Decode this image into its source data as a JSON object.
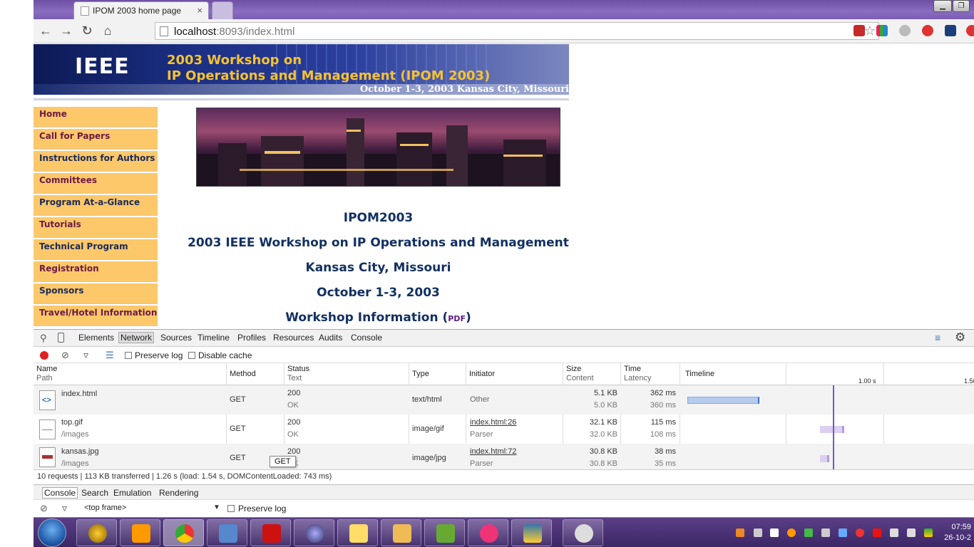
{
  "browser": {
    "tab_title": "IPOM 2003 home page",
    "tab_close": "×",
    "url_host": "localhost",
    "url_rest": ":8093/index.html"
  },
  "banner": {
    "logo": "IEEE",
    "title_line1": "2003 Workshop on",
    "title_line2": "IP Operations and Management (IPOM 2003)",
    "date_line": "October 1-3, 2003 Kansas City, Missouri"
  },
  "sidebar": {
    "items": [
      {
        "label": "Home",
        "color": "maroon"
      },
      {
        "label": "Call for Papers",
        "color": "maroon"
      },
      {
        "label": "Instructions for Authors",
        "color": "navy"
      },
      {
        "label": "Committees",
        "color": "maroon"
      },
      {
        "label": "Program At-a-Glance",
        "color": "navy"
      },
      {
        "label": "Tutorials",
        "color": "maroon"
      },
      {
        "label": "Technical Program",
        "color": "navy"
      },
      {
        "label": "Registration",
        "color": "maroon"
      },
      {
        "label": "Sponsors",
        "color": "navy"
      },
      {
        "label": "Travel/Hotel Information",
        "color": "maroon"
      }
    ]
  },
  "main": {
    "heading1": "IPOM2003",
    "heading2": "2003 IEEE Workshop on IP Operations and Management",
    "heading3": "Kansas City, Missouri",
    "heading4": "October 1-3, 2003",
    "heading5_prefix": "Workshop Information (",
    "heading5_link": "PDF",
    "heading5_suffix": ")"
  },
  "devtools": {
    "tabs": [
      "Elements",
      "Network",
      "Sources",
      "Timeline",
      "Profiles",
      "Resources",
      "Audits",
      "Console"
    ],
    "selected_tab": "Network",
    "preserve_log": "Preserve log",
    "disable_cache": "Disable cache",
    "headers": {
      "name": "Name",
      "path": "Path",
      "method": "Method",
      "status": "Status",
      "text": "Text",
      "type": "Type",
      "initiator": "Initiator",
      "size": "Size",
      "content": "Content",
      "time": "Time",
      "latency": "Latency",
      "timeline": "Timeline",
      "tick1": "1.00 s",
      "tick2": "1.50"
    },
    "rows": [
      {
        "name": "index.html",
        "path": "",
        "method": "GET",
        "status": "200",
        "status_text": "OK",
        "type": "text/html",
        "initiator": "Other",
        "initiator_sub": "",
        "size": "5.1 KB",
        "content": "5.0 KB",
        "time": "362 ms",
        "latency": "360 ms"
      },
      {
        "name": "top.gif",
        "path": "/images",
        "method": "GET",
        "status": "200",
        "status_text": "OK",
        "type": "image/gif",
        "initiator": "index.html:26",
        "initiator_sub": "Parser",
        "size": "32.1 KB",
        "content": "32.0 KB",
        "time": "115 ms",
        "latency": "108 ms"
      },
      {
        "name": "kansas.jpg",
        "path": "/images",
        "method": "GET",
        "status": "200",
        "status_text": "OK",
        "type": "image/jpg",
        "initiator": "index.html:72",
        "initiator_sub": "Parser",
        "size": "30.8 KB",
        "content": "30.8 KB",
        "time": "38 ms",
        "latency": "35 ms"
      }
    ],
    "summary": "10 requests | 113 KB transferred | 1.26 s (load: 1.54 s, DOMContentLoaded: 743 ms)",
    "tooltip": "GET",
    "drawer_tabs": [
      "Console",
      "Search",
      "Emulation",
      "Rendering"
    ],
    "frame_select": "<top frame>",
    "console_preserve": "Preserve log"
  },
  "taskbar": {
    "clock_time": "07:59",
    "clock_date": "26-10-2"
  },
  "colors": {
    "nav_bg": "#fcc86a",
    "nav_maroon": "#6c1a44",
    "nav_navy": "#1c2a58",
    "heading": "#123062",
    "banner_gold": "#f6c231",
    "taskbar": "#4a3278"
  }
}
